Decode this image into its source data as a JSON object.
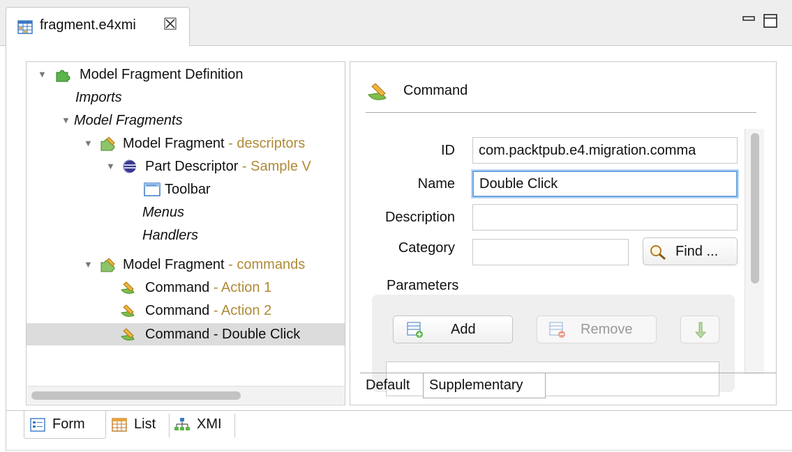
{
  "editor_tab": {
    "title": "fragment.e4xmi",
    "close_glyph": "✕",
    "icon": "table-editor-icon"
  },
  "window_controls": {
    "minimize_icon": "minimize-icon",
    "maximize_icon": "maximize-icon"
  },
  "tree": {
    "rows": [
      {
        "label": "Model Fragment Definition",
        "suffix": "",
        "italic": false,
        "icon": "puzzle-icon"
      },
      {
        "label": "Imports",
        "suffix": "",
        "italic": true,
        "icon": ""
      },
      {
        "label": "Model Fragments",
        "suffix": "",
        "italic": true,
        "icon": ""
      },
      {
        "label": "Model Fragment",
        "suffix": " - descriptors",
        "italic": false,
        "icon": "fragment-icon"
      },
      {
        "label": "Part Descriptor",
        "suffix": " - Sample V",
        "italic": false,
        "icon": "eclipse-icon"
      },
      {
        "label": "Toolbar",
        "suffix": "",
        "italic": false,
        "icon": "toolbar-icon"
      },
      {
        "label": "Menus",
        "suffix": "",
        "italic": true,
        "icon": ""
      },
      {
        "label": "Handlers",
        "suffix": "",
        "italic": true,
        "icon": ""
      },
      {
        "label": "Model Fragment",
        "suffix": " - commands",
        "italic": false,
        "icon": "fragment-icon"
      },
      {
        "label": "Command",
        "suffix": " - Action 1",
        "italic": false,
        "icon": "command-icon"
      },
      {
        "label": "Command",
        "suffix": " - Action 2",
        "italic": false,
        "icon": "command-icon"
      },
      {
        "label": "Command - Double Click",
        "suffix": "",
        "italic": false,
        "icon": "command-icon",
        "selected": true
      }
    ]
  },
  "details": {
    "title": "Command",
    "fields": {
      "id_label": "ID",
      "id_value": "com.packtpub.e4.migration.comma",
      "name_label": "Name",
      "name_value": "Double Click",
      "description_label": "Description",
      "description_value": "",
      "category_label": "Category",
      "category_value": "",
      "find_label": "Find ..."
    },
    "parameters_label": "Parameters",
    "buttons": {
      "add": "Add",
      "remove": "Remove"
    },
    "tabs": [
      "Default",
      "Supplementary"
    ]
  },
  "page_tabs": [
    {
      "label": "Form",
      "icon": "form-icon"
    },
    {
      "label": "List",
      "icon": "list-icon"
    },
    {
      "label": "XMI",
      "icon": "hierarchy-icon"
    }
  ],
  "colors": {
    "secondary_text": "#b08a36",
    "selection": "#dcdcdc",
    "focus_ring": "#6aa4e0"
  }
}
